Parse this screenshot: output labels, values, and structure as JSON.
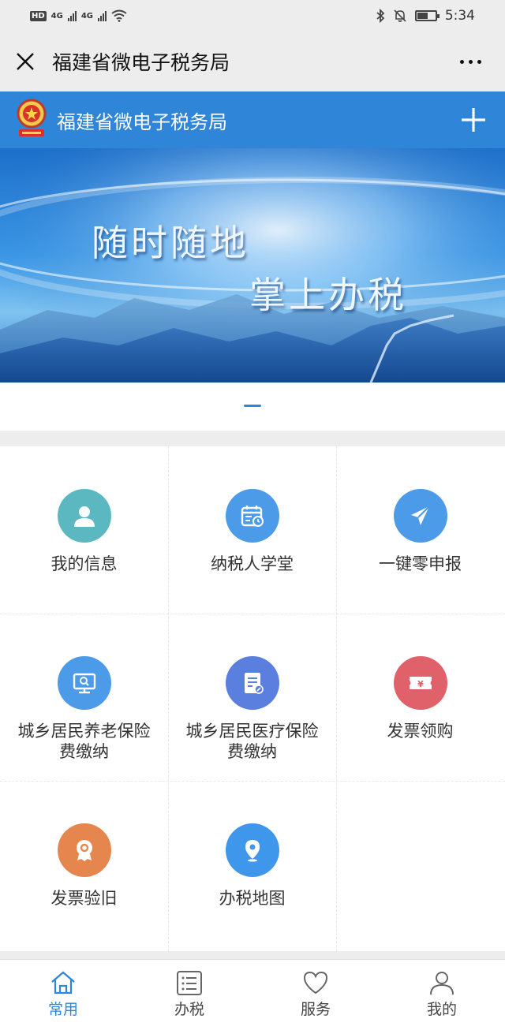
{
  "status_bar": {
    "hd_badge": "HD",
    "network_1": "4G",
    "network_2": "4G",
    "time": "5:34",
    "battery_level": 0.6
  },
  "title_bar": {
    "title": "福建省微电子税务局"
  },
  "app_header": {
    "title": "福建省微电子税务局"
  },
  "banner": {
    "line1": "随时随地",
    "line2": "掌上办税"
  },
  "services": [
    {
      "label": "我的信息",
      "icon": "user-icon",
      "color": "#5cb8c0"
    },
    {
      "label": "纳税人学堂",
      "icon": "calendar-clock-icon",
      "color": "#4c9be8"
    },
    {
      "label": "一键零申报",
      "icon": "paper-plane-icon",
      "color": "#4c9be8"
    },
    {
      "label": "城乡居民养老保险费缴纳",
      "icon": "monitor-search-icon",
      "color": "#4c9be8"
    },
    {
      "label": "城乡居民医疗保险费缴纳",
      "icon": "document-edit-icon",
      "color": "#5a7fde"
    },
    {
      "label": "发票领购",
      "icon": "ticket-yuan-icon",
      "color": "#e0616a"
    },
    {
      "label": "发票验旧",
      "icon": "badge-icon",
      "color": "#e4864e"
    },
    {
      "label": "办税地图",
      "icon": "map-pin-icon",
      "color": "#3f97ec"
    }
  ],
  "bottom_nav": [
    {
      "label": "常用",
      "icon": "home-icon",
      "active": true
    },
    {
      "label": "办税",
      "icon": "list-icon",
      "active": false
    },
    {
      "label": "服务",
      "icon": "heart-icon",
      "active": false
    },
    {
      "label": "我的",
      "icon": "person-icon",
      "active": false
    }
  ],
  "colors": {
    "brand_blue": "#2f86d8",
    "background": "#ededed"
  }
}
